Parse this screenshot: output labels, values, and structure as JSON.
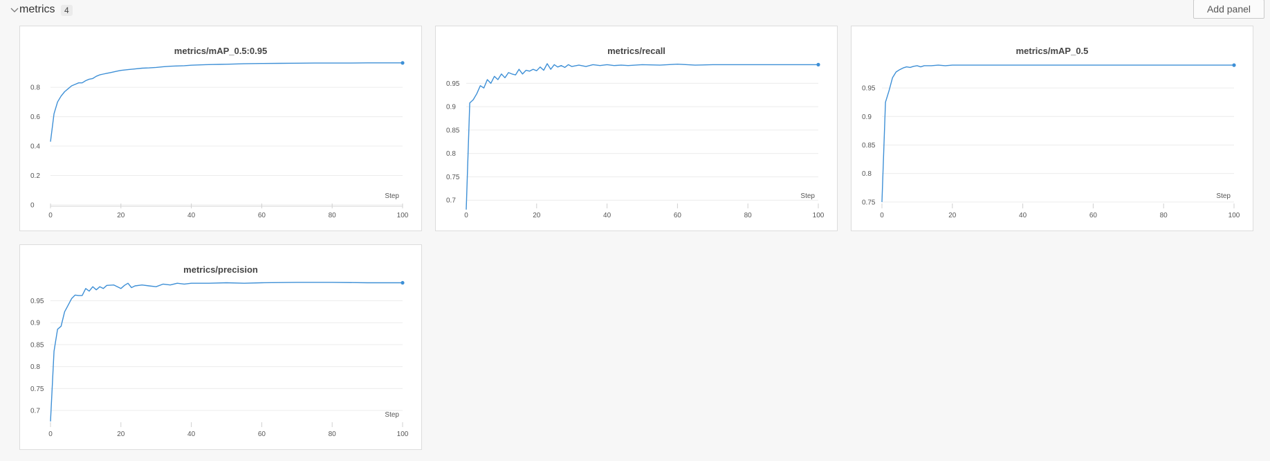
{
  "section": {
    "title": "metrics",
    "count": "4",
    "add_panel_label": "Add panel"
  },
  "colors": {
    "line": "#3d8fd6",
    "grid": "#ececec",
    "tick_text": "#555555"
  },
  "chart_data": [
    {
      "type": "line",
      "title": "metrics/mAP_0.5:0.95",
      "xlabel": "Step",
      "ylabel": "",
      "xlim": [
        0,
        100
      ],
      "ylim": [
        0,
        0.97
      ],
      "xticks": [
        0,
        20,
        40,
        60,
        80,
        100
      ],
      "xtick_labels": [
        "0",
        "20",
        "40",
        "60",
        "80",
        "100"
      ],
      "yticks": [
        0,
        0.2,
        0.4,
        0.6,
        0.8
      ],
      "ytick_labels": [
        "0",
        "0.2",
        "0.4",
        "0.6",
        "0.8"
      ],
      "grid": true,
      "show_x_axis_line": true,
      "x": [
        0,
        1,
        2,
        3,
        4,
        5,
        6,
        7,
        8,
        9,
        10,
        11,
        12,
        13,
        14,
        15,
        16,
        17,
        18,
        19,
        20,
        22,
        24,
        26,
        28,
        30,
        32,
        34,
        36,
        38,
        40,
        42,
        44,
        46,
        48,
        50,
        55,
        60,
        65,
        70,
        75,
        80,
        85,
        90,
        95,
        100
      ],
      "y": [
        0.43,
        0.62,
        0.7,
        0.74,
        0.77,
        0.79,
        0.81,
        0.82,
        0.83,
        0.83,
        0.845,
        0.855,
        0.86,
        0.875,
        0.885,
        0.89,
        0.895,
        0.9,
        0.905,
        0.91,
        0.915,
        0.92,
        0.925,
        0.93,
        0.932,
        0.935,
        0.94,
        0.943,
        0.945,
        0.947,
        0.95,
        0.952,
        0.954,
        0.955,
        0.956,
        0.957,
        0.96,
        0.962,
        0.963,
        0.964,
        0.965,
        0.965,
        0.965,
        0.966,
        0.966,
        0.966
      ]
    },
    {
      "type": "line",
      "title": "metrics/recall",
      "xlabel": "Step",
      "ylabel": "",
      "xlim": [
        0,
        100
      ],
      "ylim": [
        0.69,
        0.995
      ],
      "xticks": [
        0,
        20,
        40,
        60,
        80,
        100
      ],
      "xtick_labels": [
        "0",
        "20",
        "40",
        "60",
        "80",
        "100"
      ],
      "yticks": [
        0.7,
        0.75,
        0.8,
        0.85,
        0.9,
        0.95
      ],
      "ytick_labels": [
        "0.7",
        "0.75",
        "0.8",
        "0.85",
        "0.9",
        "0.95"
      ],
      "grid": true,
      "show_x_axis_line": false,
      "x": [
        0,
        1,
        2,
        3,
        4,
        5,
        6,
        7,
        8,
        9,
        10,
        11,
        12,
        13,
        14,
        15,
        16,
        17,
        18,
        19,
        20,
        21,
        22,
        23,
        24,
        25,
        26,
        27,
        28,
        29,
        30,
        32,
        34,
        36,
        38,
        40,
        42,
        44,
        46,
        48,
        50,
        55,
        60,
        65,
        70,
        75,
        80,
        85,
        90,
        95,
        100
      ],
      "y": [
        0.68,
        0.908,
        0.915,
        0.928,
        0.945,
        0.94,
        0.958,
        0.95,
        0.965,
        0.958,
        0.97,
        0.962,
        0.973,
        0.97,
        0.968,
        0.98,
        0.97,
        0.978,
        0.976,
        0.98,
        0.977,
        0.985,
        0.978,
        0.992,
        0.98,
        0.99,
        0.985,
        0.988,
        0.984,
        0.99,
        0.986,
        0.989,
        0.986,
        0.99,
        0.988,
        0.99,
        0.988,
        0.989,
        0.988,
        0.989,
        0.99,
        0.989,
        0.991,
        0.989,
        0.99,
        0.99,
        0.99,
        0.99,
        0.99,
        0.99,
        0.99
      ]
    },
    {
      "type": "line",
      "title": "metrics/mAP_0.5",
      "xlabel": "Step",
      "ylabel": "",
      "xlim": [
        0,
        100
      ],
      "ylim": [
        0.745,
        0.995
      ],
      "xticks": [
        0,
        20,
        40,
        60,
        80,
        100
      ],
      "xtick_labels": [
        "0",
        "20",
        "40",
        "60",
        "80",
        "100"
      ],
      "yticks": [
        0.75,
        0.8,
        0.85,
        0.9,
        0.95
      ],
      "ytick_labels": [
        "0.75",
        "0.8",
        "0.85",
        "0.9",
        "0.95"
      ],
      "grid": true,
      "show_x_axis_line": false,
      "x": [
        0,
        1,
        2,
        3,
        4,
        5,
        6,
        7,
        8,
        9,
        10,
        11,
        12,
        14,
        16,
        18,
        20,
        25,
        30,
        35,
        40,
        50,
        60,
        70,
        80,
        90,
        100
      ],
      "y": [
        0.75,
        0.925,
        0.945,
        0.968,
        0.978,
        0.982,
        0.985,
        0.987,
        0.986,
        0.988,
        0.989,
        0.987,
        0.989,
        0.989,
        0.99,
        0.989,
        0.99,
        0.99,
        0.99,
        0.99,
        0.99,
        0.99,
        0.99,
        0.99,
        0.99,
        0.99,
        0.99
      ]
    },
    {
      "type": "line",
      "title": "metrics/precision",
      "xlabel": "Step",
      "ylabel": "",
      "xlim": [
        0,
        100
      ],
      "ylim": [
        0.67,
        0.995
      ],
      "xticks": [
        0,
        20,
        40,
        60,
        80,
        100
      ],
      "xtick_labels": [
        "0",
        "20",
        "40",
        "60",
        "80",
        "100"
      ],
      "yticks": [
        0.7,
        0.75,
        0.8,
        0.85,
        0.9,
        0.95
      ],
      "ytick_labels": [
        "0.7",
        "0.75",
        "0.8",
        "0.85",
        "0.9",
        "0.95"
      ],
      "grid": true,
      "show_x_axis_line": false,
      "x": [
        0,
        1,
        2,
        3,
        4,
        5,
        6,
        7,
        8,
        9,
        10,
        11,
        12,
        13,
        14,
        15,
        16,
        18,
        20,
        21,
        22,
        23,
        24,
        26,
        28,
        30,
        32,
        34,
        36,
        38,
        40,
        45,
        50,
        55,
        60,
        70,
        80,
        90,
        100
      ],
      "y": [
        0.675,
        0.835,
        0.885,
        0.892,
        0.925,
        0.94,
        0.955,
        0.963,
        0.962,
        0.962,
        0.978,
        0.972,
        0.982,
        0.975,
        0.982,
        0.978,
        0.985,
        0.986,
        0.978,
        0.985,
        0.99,
        0.98,
        0.984,
        0.986,
        0.984,
        0.982,
        0.988,
        0.986,
        0.99,
        0.988,
        0.99,
        0.99,
        0.991,
        0.99,
        0.991,
        0.992,
        0.992,
        0.991,
        0.991
      ]
    }
  ]
}
